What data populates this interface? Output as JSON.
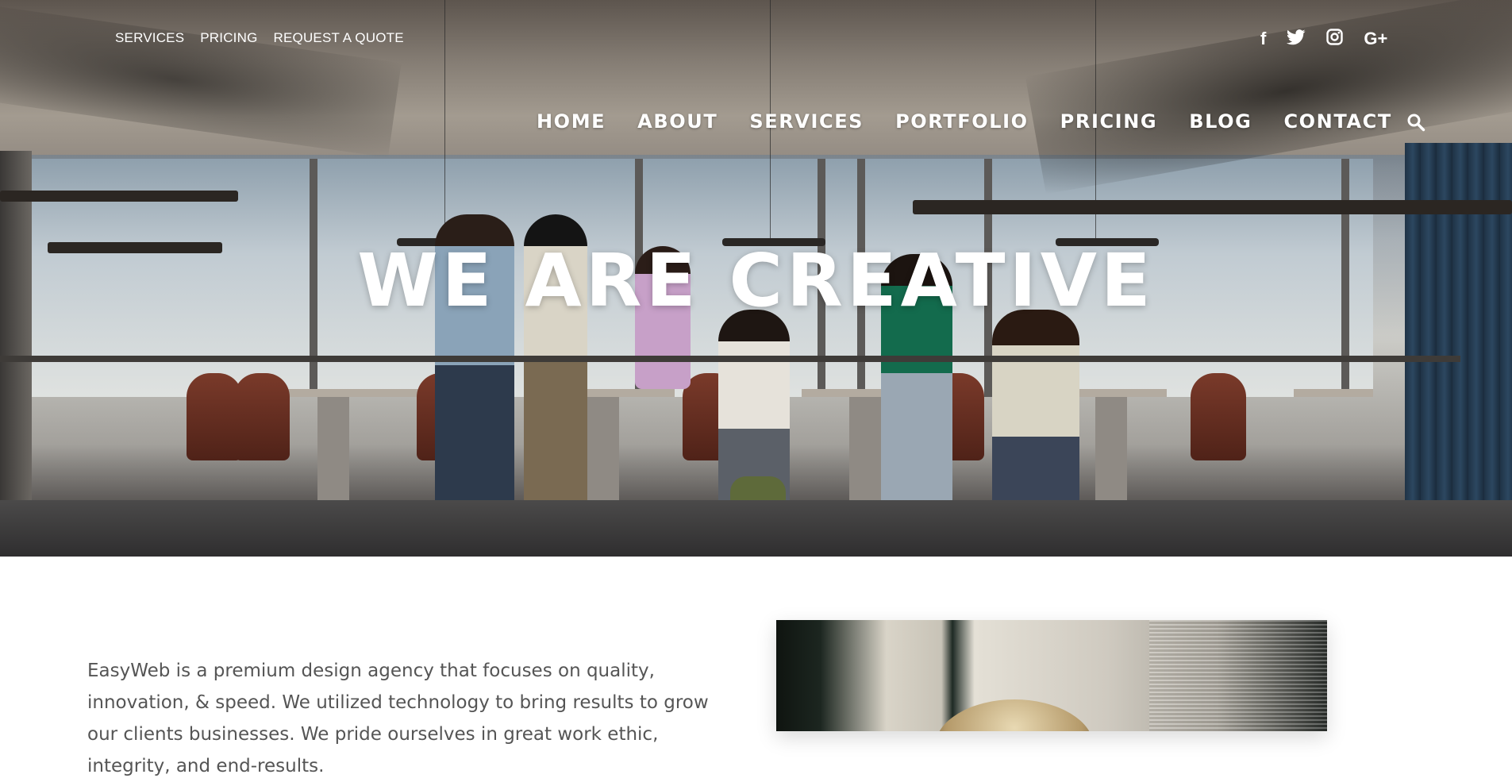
{
  "topbar": {
    "links": [
      "SERVICES",
      "PRICING",
      "REQUEST A QUOTE"
    ]
  },
  "social": {
    "icons": [
      "facebook-icon",
      "twitter-icon",
      "instagram-icon",
      "google-plus-icon"
    ],
    "glyphs": [
      "f",
      "t",
      "◎",
      "G+"
    ]
  },
  "nav": {
    "items": [
      "HOME",
      "ABOUT",
      "SERVICES",
      "PORTFOLIO",
      "PRICING",
      "BLOG",
      "CONTACT"
    ],
    "search_icon": "search-icon"
  },
  "hero": {
    "title": "WE ARE CREATIVE"
  },
  "intro": {
    "text": "EasyWeb is a premium design agency that focuses on quality, innovation, & speed. We utilized technology to bring results to grow our clients businesses. We pride ourselves in great work ethic, integrity, and end-results."
  },
  "colors": {
    "text_white": "#ffffff",
    "body_text": "#555555"
  }
}
